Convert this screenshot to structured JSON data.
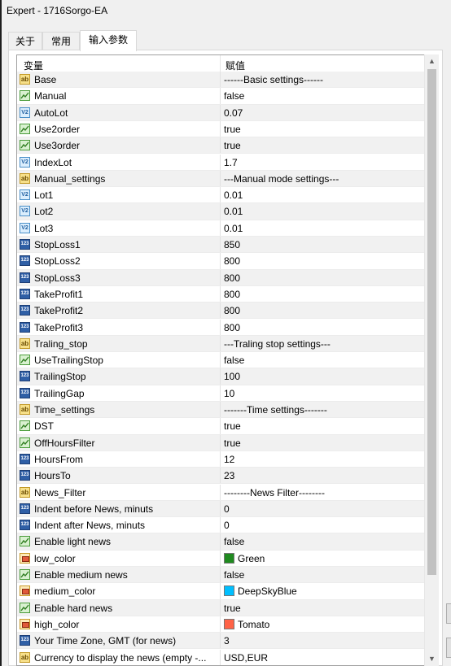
{
  "window": {
    "title": "Expert - 1716Sorgo-EA"
  },
  "tabs": [
    {
      "label": "关于",
      "active": false
    },
    {
      "label": "常用",
      "active": false
    },
    {
      "label": "输入参数",
      "active": true
    }
  ],
  "grid": {
    "headers": {
      "variable": "变量",
      "value": "赋值"
    },
    "rows": [
      {
        "icon": "ab-icon",
        "name": "Base",
        "value": "------Basic settings------"
      },
      {
        "icon": "bool-icon",
        "name": "Manual",
        "value": "false"
      },
      {
        "icon": "double-icon",
        "name": "AutoLot",
        "value": "0.07"
      },
      {
        "icon": "bool-icon",
        "name": "Use2order",
        "value": "true"
      },
      {
        "icon": "bool-icon",
        "name": "Use3order",
        "value": "true"
      },
      {
        "icon": "double-icon",
        "name": "IndexLot",
        "value": "1.7"
      },
      {
        "icon": "ab-icon",
        "name": "Manual_settings",
        "value": "---Manual mode settings---"
      },
      {
        "icon": "double-icon",
        "name": "Lot1",
        "value": "0.01"
      },
      {
        "icon": "double-icon",
        "name": "Lot2",
        "value": "0.01"
      },
      {
        "icon": "double-icon",
        "name": "Lot3",
        "value": "0.01"
      },
      {
        "icon": "int-icon",
        "name": "StopLoss1",
        "value": "850"
      },
      {
        "icon": "int-icon",
        "name": "StopLoss2",
        "value": "800"
      },
      {
        "icon": "int-icon",
        "name": "StopLoss3",
        "value": "800"
      },
      {
        "icon": "int-icon",
        "name": "TakeProfit1",
        "value": "800"
      },
      {
        "icon": "int-icon",
        "name": "TakeProfit2",
        "value": "800"
      },
      {
        "icon": "int-icon",
        "name": "TakeProfit3",
        "value": "800"
      },
      {
        "icon": "ab-icon",
        "name": "Traling_stop",
        "value": "---Traling stop settings---"
      },
      {
        "icon": "bool-icon",
        "name": "UseTrailingStop",
        "value": "false"
      },
      {
        "icon": "int-icon",
        "name": "TrailingStop",
        "value": "100"
      },
      {
        "icon": "int-icon",
        "name": "TrailingGap",
        "value": "10"
      },
      {
        "icon": "ab-icon",
        "name": "Time_settings",
        "value": "-------Time settings-------"
      },
      {
        "icon": "bool-icon",
        "name": "DST",
        "value": "true"
      },
      {
        "icon": "bool-icon",
        "name": "OffHoursFilter",
        "value": "true"
      },
      {
        "icon": "int-icon",
        "name": "HoursFrom",
        "value": "12"
      },
      {
        "icon": "int-icon",
        "name": "HoursTo",
        "value": "23"
      },
      {
        "icon": "ab-icon",
        "name": "News_Filter",
        "value": "--------News Filter--------"
      },
      {
        "icon": "int-icon",
        "name": "Indent before News, minuts",
        "value": "0"
      },
      {
        "icon": "int-icon",
        "name": "Indent after News, minuts",
        "value": "0"
      },
      {
        "icon": "bool-icon",
        "name": "Enable light news",
        "value": "false"
      },
      {
        "icon": "color-icon",
        "name": "low_color",
        "value": "Green",
        "swatch": "#1f8a1f"
      },
      {
        "icon": "bool-icon",
        "name": "Enable medium news",
        "value": "false"
      },
      {
        "icon": "color-icon",
        "name": "medium_color",
        "value": "DeepSkyBlue",
        "swatch": "#00bfff"
      },
      {
        "icon": "bool-icon",
        "name": "Enable hard news",
        "value": "true"
      },
      {
        "icon": "color-icon",
        "name": "high_color",
        "value": "Tomato",
        "swatch": "#ff6347"
      },
      {
        "icon": "int-icon",
        "name": "Your Time Zone, GMT (for news)",
        "value": "3"
      },
      {
        "icon": "ab-icon",
        "name": "Currency to display the news (empty -...",
        "value": "USD,EUR"
      }
    ]
  },
  "scrollbar": {
    "up_icon": "▲",
    "down_icon": "▼"
  }
}
